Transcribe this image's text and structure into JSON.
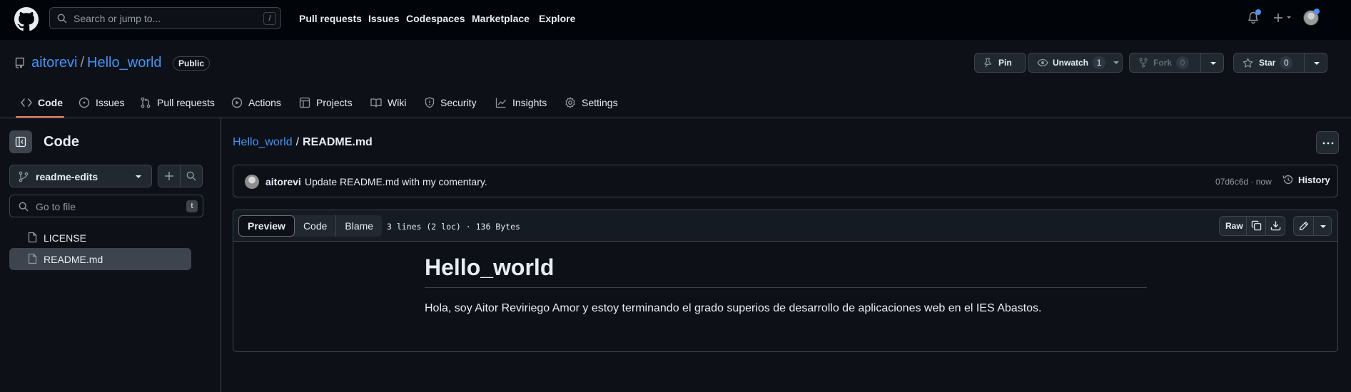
{
  "header": {
    "search_placeholder": "Search or jump to...",
    "search_shortcut": "/",
    "nav": [
      "Pull requests",
      "Issues",
      "Codespaces",
      "Marketplace",
      "Explore"
    ]
  },
  "repo": {
    "owner": "aitorevi",
    "separator": "/",
    "name": "Hello_world",
    "visibility": "Public",
    "actions": {
      "pin_label": "Pin",
      "watch_label": "Unwatch",
      "watch_count": "1",
      "fork_label": "Fork",
      "fork_count": "0",
      "star_label": "Star",
      "star_count": "0"
    }
  },
  "tabs": [
    "Code",
    "Issues",
    "Pull requests",
    "Actions",
    "Projects",
    "Wiki",
    "Security",
    "Insights",
    "Settings"
  ],
  "sidebar": {
    "title": "Code",
    "branch": "readme-edits",
    "goto_placeholder": "Go to file",
    "goto_shortcut": "t",
    "files": [
      "LICENSE",
      "README.md"
    ]
  },
  "file": {
    "breadcrumb_repo": "Hello_world",
    "breadcrumb_sep": "/",
    "breadcrumb_file": "README.md",
    "commit": {
      "author": "aitorevi",
      "message": "Update README.md with my comentary.",
      "sha": "07d6c6d",
      "dot": "·",
      "time": "now",
      "history_label": "History"
    },
    "view_modes": [
      "Preview",
      "Code",
      "Blame"
    ],
    "info": "3 lines (2 loc) · 136 Bytes",
    "raw_label": "Raw"
  },
  "readme": {
    "heading": "Hello_world",
    "paragraph": "Hola, soy Aitor Reviriego Amor y estoy terminando el grado superios de desarrollo de aplicaciones web en el IES Abastos."
  },
  "colors": {
    "accent_link": "#4493f8",
    "tab_underline": "#f78166",
    "notification_dot": "#4493f8"
  }
}
